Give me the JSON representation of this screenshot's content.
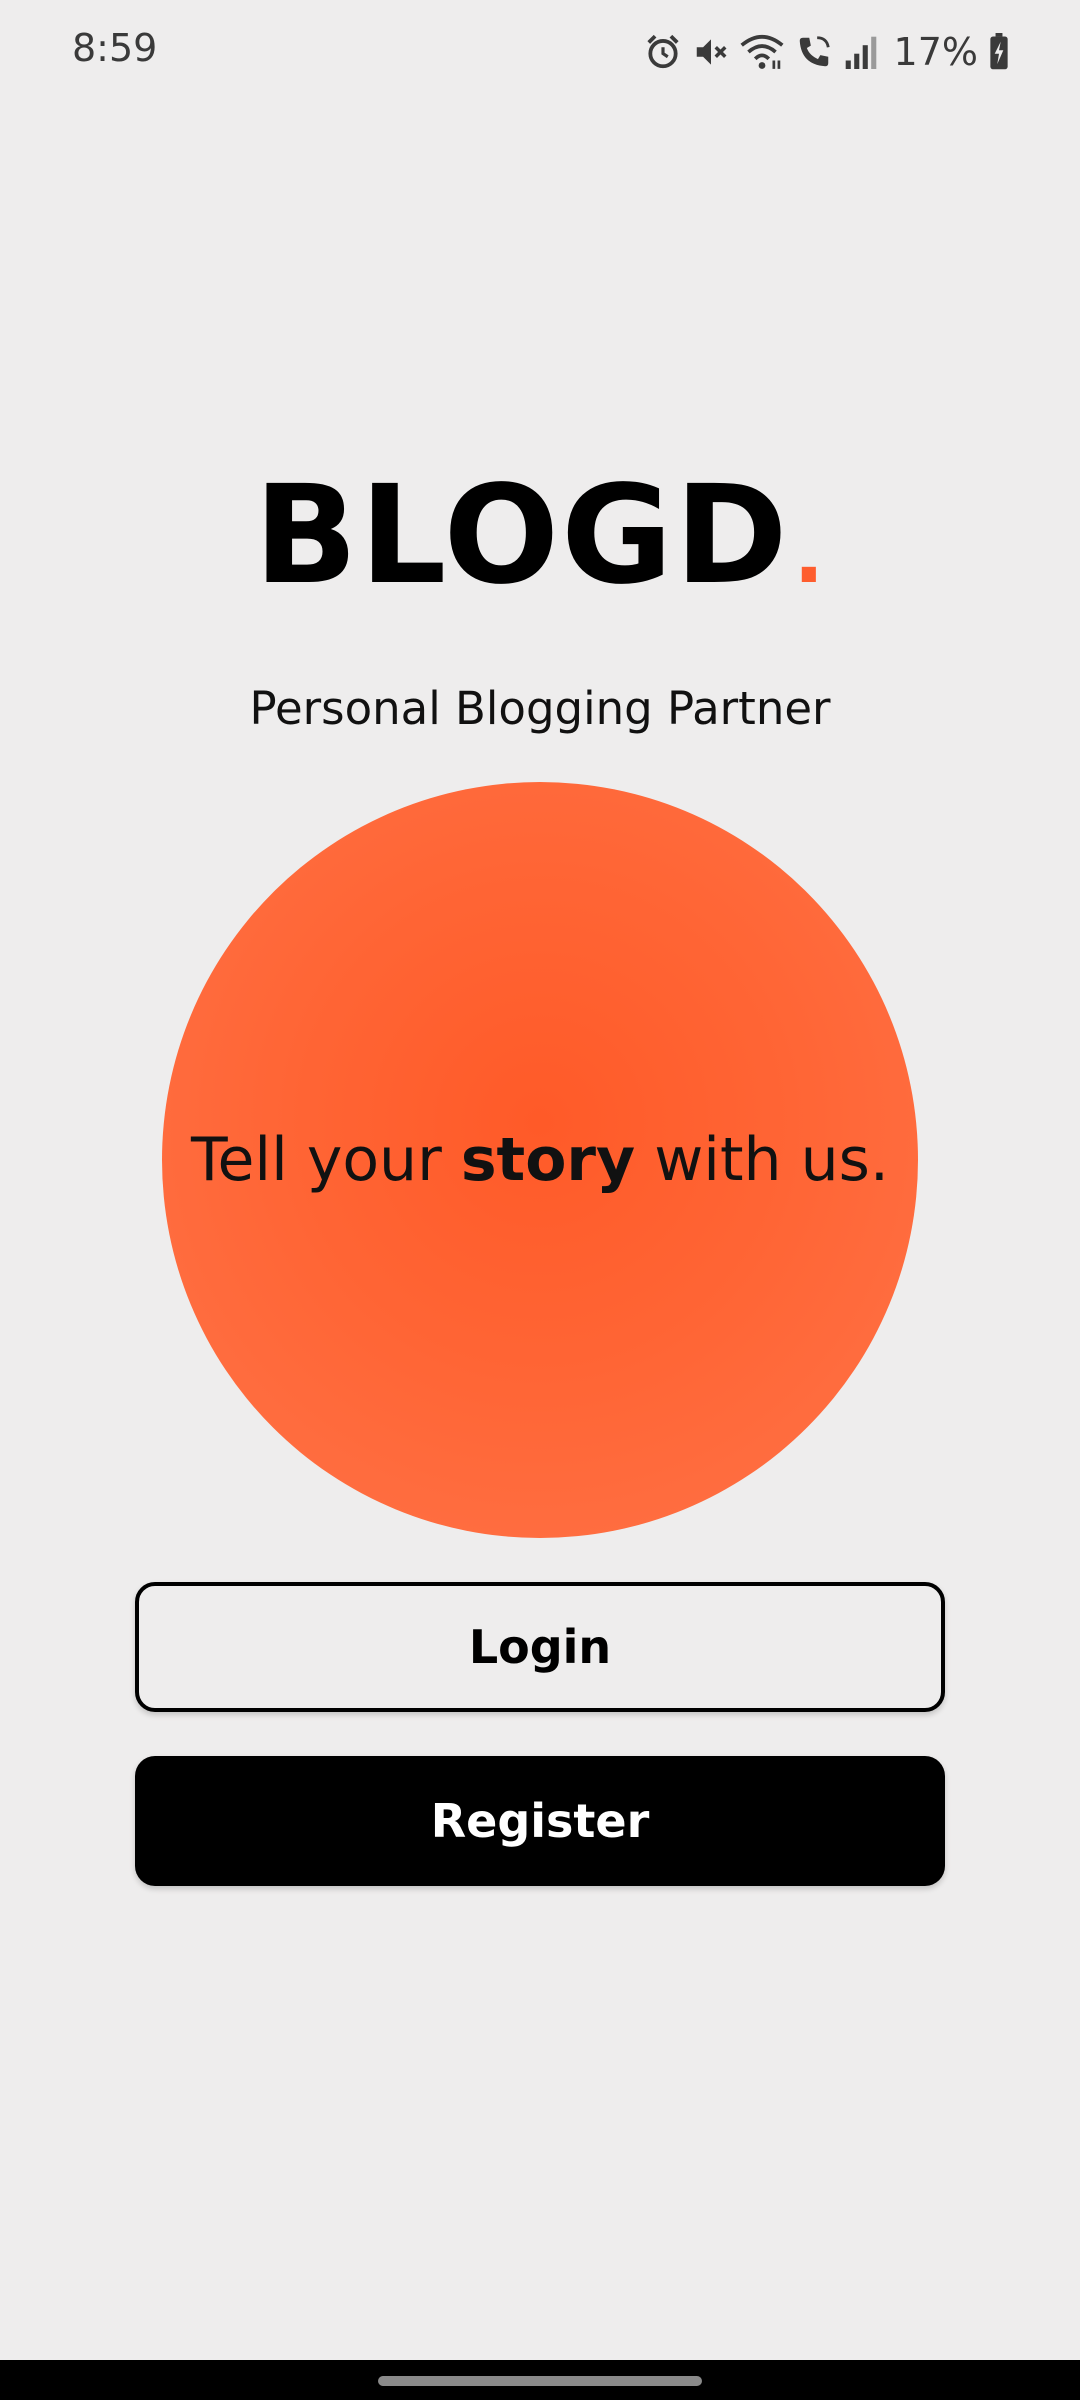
{
  "status_bar": {
    "time": "8:59",
    "battery": "17%",
    "icons": [
      "alarm-icon",
      "mute-icon",
      "wifi-icon",
      "wifi-call-icon",
      "signal-icon",
      "battery-charging-icon"
    ]
  },
  "logo": {
    "text": "BLOGD",
    "dot": ".",
    "dot_color": "#fe5d2e"
  },
  "tagline": "Personal Blogging Partner",
  "hero": {
    "before": "Tell your ",
    "emphasis": "story",
    "after": " with us.",
    "circle_color": "#ff6535"
  },
  "buttons": {
    "login": "Login",
    "register": "Register"
  }
}
